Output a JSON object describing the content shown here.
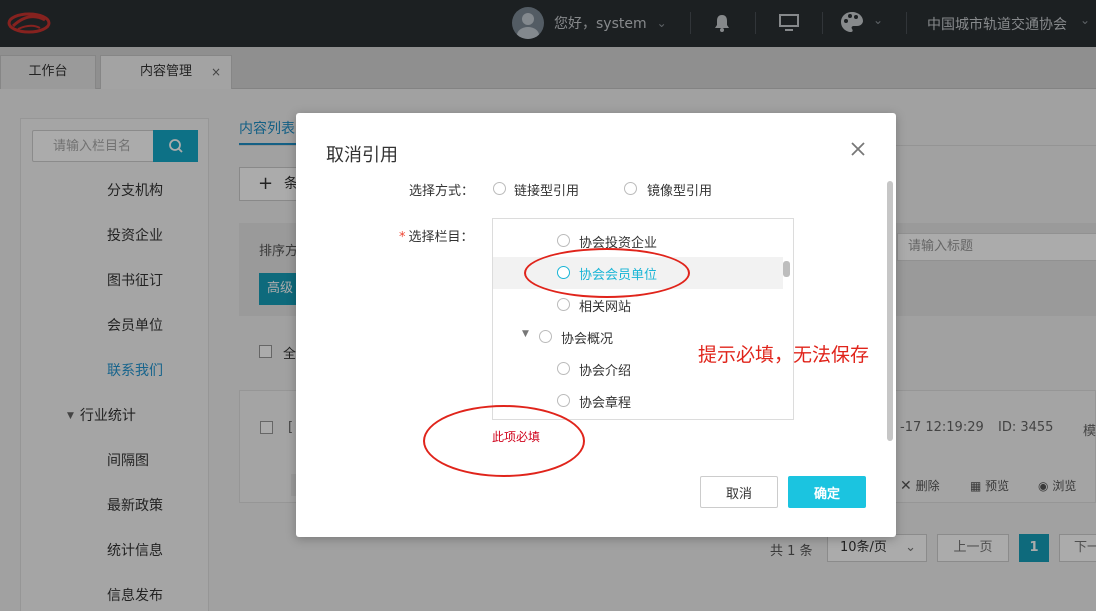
{
  "header": {
    "greeting": "您好，system",
    "org_name": "中国城市轨道交通协会"
  },
  "tabs": [
    {
      "label": "工作台"
    },
    {
      "label": "内容管理",
      "close": "×"
    }
  ],
  "sidebar": {
    "search_placeholder": "请输入栏目名",
    "items": [
      {
        "label": "分支机构"
      },
      {
        "label": "投资企业"
      },
      {
        "label": "图书征订"
      },
      {
        "label": "会员单位"
      },
      {
        "label": "联系我们"
      },
      {
        "label": "行业统计"
      },
      {
        "label": "间隔图"
      },
      {
        "label": "最新政策"
      },
      {
        "label": "统计信息"
      },
      {
        "label": "信息发布"
      }
    ]
  },
  "main": {
    "tab_label": "内容列表",
    "new_button": "条",
    "filter_label": "排序方",
    "title_placeholder": "请输入标题",
    "adv_button": "高级",
    "select_all": "全",
    "row": {
      "bracket": "[",
      "timestamp": "-17 12:19:29",
      "id": "ID:  3455",
      "tail": "模"
    },
    "actions": {
      "delete": "删除",
      "preview": "预览",
      "browse": "浏览"
    },
    "pager": {
      "total": "共 1 条",
      "page_size": "10条/页",
      "prev": "上一页",
      "current": "1",
      "next": "下一"
    }
  },
  "modal": {
    "title": "取消引用",
    "mode_label": "选择方式：",
    "mode_options": [
      "链接型引用",
      "镜像型引用"
    ],
    "column_label": "选择栏目：",
    "tree": [
      {
        "label": "协会投资企业"
      },
      {
        "label": "协会会员单位"
      },
      {
        "label": "相关网站"
      },
      {
        "label": "协会概况"
      },
      {
        "label": "协会介绍"
      },
      {
        "label": "协会章程"
      }
    ],
    "error": "此项必填",
    "cancel": "取消",
    "ok": "确定"
  },
  "annotation": "提示必填，无法保存",
  "colors": {
    "accent": "#1bc4e0",
    "annotation_red": "#e0241b",
    "header_bg": "#2b3034"
  }
}
